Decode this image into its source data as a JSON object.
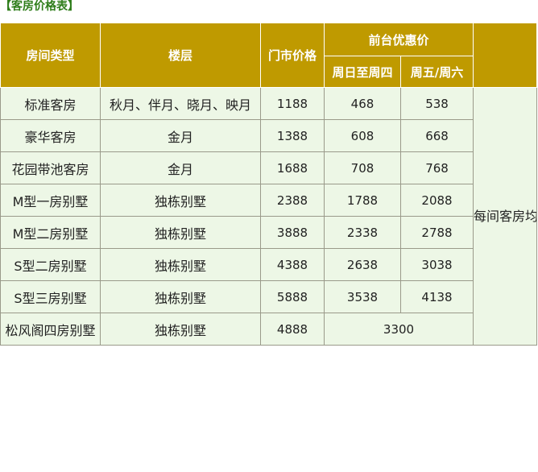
{
  "caption": "【客房价格表】",
  "headers": {
    "room_type": "房间类型",
    "floor": "楼层",
    "rack_price": "门市价格",
    "front_desk_group": "前台优惠价",
    "sun_thu": "周日至周四",
    "fri_sat": "周五/周六"
  },
  "rows": [
    {
      "type": "标准客房",
      "floor": "秋月、伴月、晓月、映月",
      "rack": "1188",
      "sun_thu": "468",
      "fri_sat": "538"
    },
    {
      "type": "豪华客房",
      "floor": "金月",
      "rack": "1388",
      "sun_thu": "608",
      "fri_sat": "668"
    },
    {
      "type": "花园带池客房",
      "floor": "金月",
      "rack": "1688",
      "sun_thu": "708",
      "fri_sat": "768"
    },
    {
      "type": "M型一房别墅",
      "floor": "独栋别墅",
      "rack": "2388",
      "sun_thu": "1788",
      "fri_sat": "2088"
    },
    {
      "type": "M型二房别墅",
      "floor": "独栋别墅",
      "rack": "3888",
      "sun_thu": "2338",
      "fri_sat": "2788"
    },
    {
      "type": "S型二房别墅",
      "floor": "独栋别墅",
      "rack": "4388",
      "sun_thu": "2638",
      "fri_sat": "3038"
    },
    {
      "type": "S型三房别墅",
      "floor": "独栋别墅",
      "rack": "5888",
      "sun_thu": "3538",
      "fri_sat": "4138"
    },
    {
      "type": "松风阁四房别墅",
      "floor": "独栋别墅",
      "rack": "4888",
      "merged": "3300"
    }
  ],
  "note": "每间客房均赠送入住期间的无限次露天温泉门票及自助早餐券。"
}
